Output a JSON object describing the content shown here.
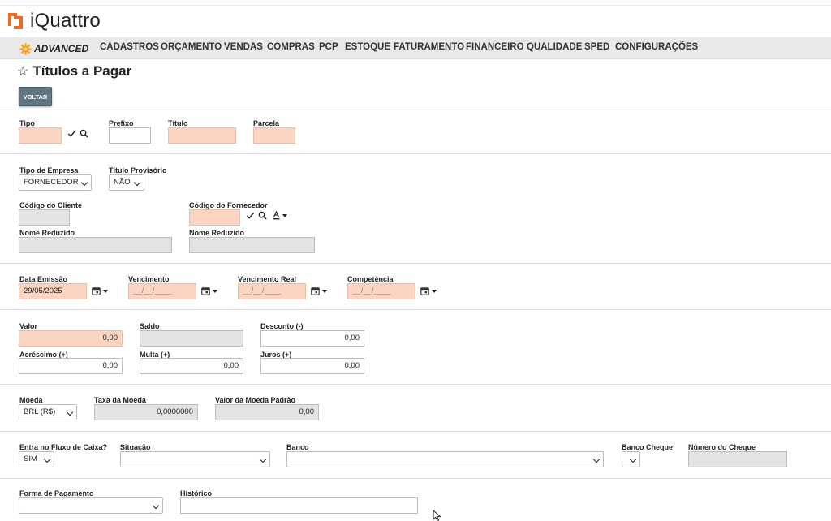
{
  "header": {
    "brand": "iQuattro",
    "brand_color": "#f26a21"
  },
  "nav": {
    "edition_label": "ADVANCED",
    "items": [
      "CADASTROS",
      "ORÇAMENTO",
      "VENDAS",
      "COMPRAS",
      "PCP",
      "ESTOQUE",
      "FATURAMENTO",
      "FINANCEIRO",
      "QUALIDADE",
      "SPED",
      "CONFIGURAÇÕES"
    ]
  },
  "page": {
    "title": "Títulos a Pagar",
    "back_button": "VOLTAR"
  },
  "section1": {
    "tipo_label": "Tipo",
    "tipo_value": "",
    "prefixo_label": "Prefixo",
    "prefixo_value": "",
    "titulo_label": "Título",
    "titulo_value": "",
    "parcela_label": "Parcela",
    "parcela_value": ""
  },
  "section2": {
    "tipo_empresa_label": "Tipo de Empresa",
    "tipo_empresa_value": "FORNECEDOR",
    "titulo_provisorio_label": "Título Provisório",
    "titulo_provisorio_value": "NÃO",
    "codigo_cliente_label": "Código do Cliente",
    "codigo_cliente_value": "",
    "codigo_fornecedor_label": "Código do Fornecedor",
    "codigo_fornecedor_value": "",
    "nome_reduzido_cliente_label": "Nome Reduzido",
    "nome_reduzido_cliente_value": "",
    "nome_reduzido_fornecedor_label": "Nome Reduzido",
    "nome_reduzido_fornecedor_value": ""
  },
  "section3": {
    "data_emissao_label": "Data Emissão",
    "data_emissao_value": "29/05/2025",
    "vencimento_label": "Vencimento",
    "vencimento_value": "__/__/____",
    "vencimento_real_label": "Vencimento Real",
    "vencimento_real_value": "__/__/____",
    "competencia_label": "Competência",
    "competencia_value": "__/__/____"
  },
  "section4": {
    "valor_label": "Valor",
    "valor_value": "0,00",
    "saldo_label": "Saldo",
    "saldo_value": "",
    "desconto_label": "Desconto (-)",
    "desconto_value": "0,00",
    "acrescimo_label": "Acréscimo (+)",
    "acrescimo_value": "0,00",
    "multa_label": "Multa (+)",
    "multa_value": "0,00",
    "juros_label": "Juros (+)",
    "juros_value": "0,00"
  },
  "section5": {
    "moeda_label": "Moeda",
    "moeda_value": "BRL (R$)",
    "taxa_moeda_label": "Taxa da Moeda",
    "taxa_moeda_value": "0,0000000",
    "valor_moeda_padrao_label": "Valor da Moeda Padrão",
    "valor_moeda_padrao_value": "0,00"
  },
  "section6": {
    "fluxo_caixa_label": "Entra no Fluxo de Caixa?",
    "fluxo_caixa_value": "SIM",
    "situacao_label": "Situação",
    "situacao_value": "",
    "banco_label": "Banco",
    "banco_value": "",
    "banco_cheque_label": "Banco Cheque",
    "banco_cheque_value": "",
    "numero_cheque_label": "Número do Cheque",
    "numero_cheque_value": ""
  },
  "section7": {
    "forma_pagamento_label": "Forma de Pagamento",
    "forma_pagamento_value": "",
    "historico_label": "Histórico",
    "historico_value": ""
  },
  "icons": {
    "confirm": "check-icon",
    "search": "search-icon",
    "calendar": "calendar-icon",
    "text_format": "text-format-icon"
  },
  "colors": {
    "required_field": "#fcd5c2",
    "disabled_field": "#e3e3e3",
    "button": "#617582",
    "gear": "#f5a623"
  }
}
